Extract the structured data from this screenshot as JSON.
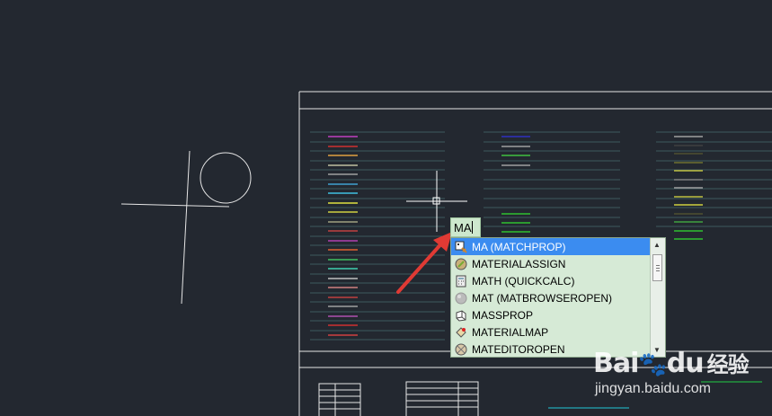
{
  "command_line": {
    "input_value": "MA"
  },
  "autocomplete": {
    "items": [
      {
        "label": "MA (MATCHPROP)",
        "icon": "match-properties-icon",
        "selected": true
      },
      {
        "label": "MATERIALASSIGN",
        "icon": "material-assign-icon",
        "selected": false
      },
      {
        "label": "MATH (QUICKCALC)",
        "icon": "calculator-icon",
        "selected": false
      },
      {
        "label": "MAT (MATBROWSEROPEN)",
        "icon": "material-browser-icon",
        "selected": false
      },
      {
        "label": "MASSPROP",
        "icon": "mass-properties-icon",
        "selected": false
      },
      {
        "label": "MATERIALMAP",
        "icon": "material-map-icon",
        "selected": false
      },
      {
        "label": "MATEDITOROPEN",
        "icon": "material-editor-icon",
        "selected": false
      }
    ],
    "selected_color": "#3b8cf0",
    "background_color": "#d6ead6"
  },
  "canvas": {
    "background_color": "#232830",
    "crosshair_color": "#ffffff",
    "annotation_arrow_color": "#e03a34"
  },
  "watermark": {
    "brand_part1": "Bai",
    "brand_part2": "du",
    "brand_part3": "经验",
    "url": "jingyan.baidu.com"
  }
}
